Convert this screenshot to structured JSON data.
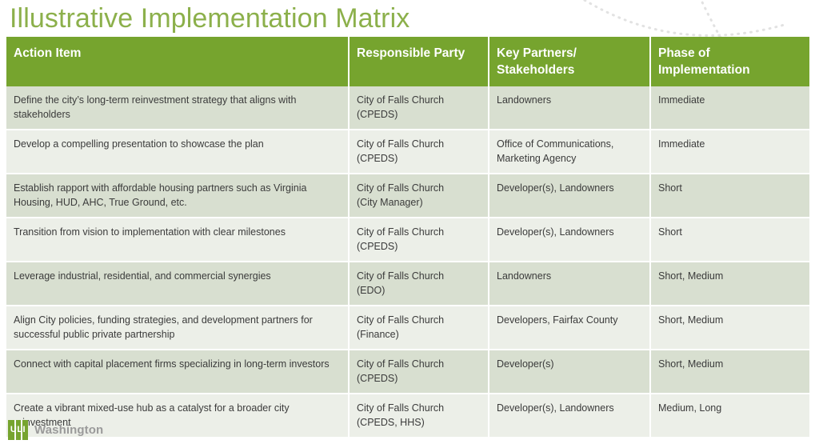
{
  "slide": {
    "title": "Illustrative Implementation Matrix"
  },
  "table": {
    "headers": [
      "Action Item",
      "Responsible Party",
      "Key Partners/ Stakeholders",
      "Phase of Implementation"
    ],
    "headers_lines": [
      [
        "Action Item"
      ],
      [
        "Responsible Party"
      ],
      [
        "Key Partners/",
        "Stakeholders"
      ],
      [
        "Phase of",
        "Implementation"
      ]
    ],
    "rows": [
      {
        "action_item": "Define the city’s long-term reinvestment strategy that aligns with stakeholders",
        "responsible_party_line1": "City of Falls Church",
        "responsible_party_line2": "(CPEDS)",
        "key_partners": "Landowners",
        "phase": "Immediate"
      },
      {
        "action_item": "Develop a compelling presentation to showcase the plan",
        "responsible_party_line1": "City of Falls Church",
        "responsible_party_line2": "(CPEDS)",
        "key_partners": "Office of Communications, Marketing Agency",
        "phase": "Immediate"
      },
      {
        "action_item": "Establish rapport with affordable housing partners such as Virginia Housing, HUD, AHC, True Ground, etc.",
        "responsible_party_line1": "City of Falls Church",
        "responsible_party_line2": "(City Manager)",
        "key_partners": "Developer(s), Landowners",
        "phase": "Short"
      },
      {
        "action_item": "Transition from vision to implementation with clear milestones",
        "responsible_party_line1": "City of Falls Church",
        "responsible_party_line2": "(CPEDS)",
        "key_partners": "Developer(s), Landowners",
        "phase": "Short"
      },
      {
        "action_item": "Leverage industrial, residential, and commercial synergies",
        "responsible_party_line1": "City of Falls Church",
        "responsible_party_line2": "(EDO)",
        "key_partners": "Landowners",
        "phase": "Short, Medium"
      },
      {
        "action_item": "Align City policies, funding strategies, and development partners for successful public private partnership",
        "responsible_party_line1": "City of Falls Church",
        "responsible_party_line2": "(Finance)",
        "key_partners": "Developers, Fairfax County",
        "phase": "Short, Medium"
      },
      {
        "action_item": "Connect with capital placement firms specializing in long-term investors",
        "responsible_party_line1": "City of Falls Church",
        "responsible_party_line2": "(CPEDS)",
        "key_partners": "Developer(s)",
        "phase": "Short, Medium"
      },
      {
        "action_item": "Create a vibrant mixed-use hub as a catalyst for a broader city reinvestment",
        "responsible_party_line1": "City of Falls Church",
        "responsible_party_line2": "(CPEDS, HHS)",
        "key_partners": "Developer(s), Landowners",
        "phase": "Medium, Long"
      }
    ]
  },
  "footer": {
    "logo_mark": "ULI",
    "logo_word": "Washington"
  },
  "colors": {
    "header_green": "#76a42e",
    "title_green": "#8cb04b",
    "row_odd": "#d8dfd0",
    "row_even": "#ecefe8",
    "body_text": "#3b3b3b",
    "logo_word_gray": "#9a9a9a"
  }
}
